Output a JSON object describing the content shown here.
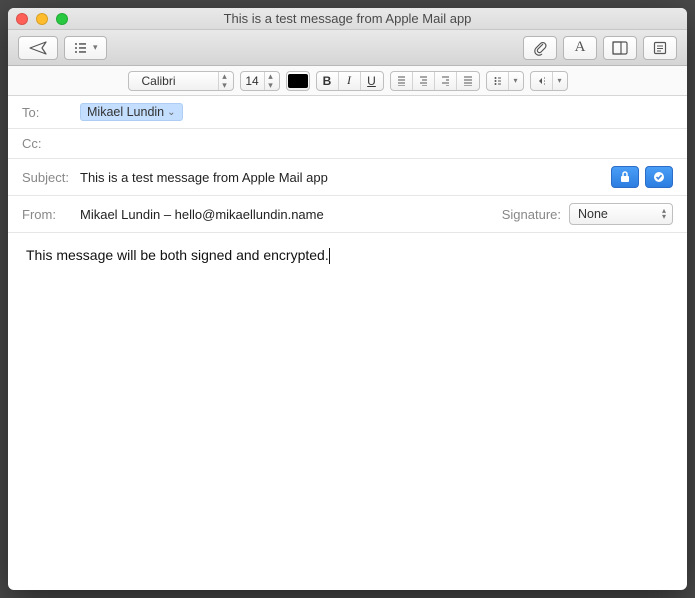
{
  "window": {
    "title": "This is a test message from Apple Mail app"
  },
  "formatbar": {
    "font": "Calibri",
    "size": "14"
  },
  "fields": {
    "to_label": "To:",
    "to_token": "Mikael Lundin",
    "cc_label": "Cc:",
    "subject_label": "Subject:",
    "subject_value": "This is a test message from Apple Mail app",
    "from_label": "From:",
    "from_value": "Mikael Lundin – hello@mikaellundin.name",
    "signature_label": "Signature:",
    "signature_value": "None"
  },
  "body": {
    "text": "This message will be both signed and encrypted."
  }
}
